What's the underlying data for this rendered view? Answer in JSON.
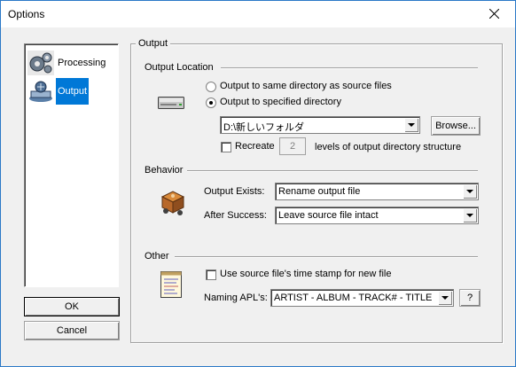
{
  "window": {
    "title": "Options"
  },
  "sidebar": {
    "items": [
      {
        "label": "Processing",
        "icon": "gears-icon",
        "selected": false
      },
      {
        "label": "Output",
        "icon": "output-icon",
        "selected": true
      }
    ]
  },
  "buttons": {
    "ok": "OK",
    "cancel": "Cancel"
  },
  "panel": {
    "title": "Output",
    "location": {
      "heading": "Output Location",
      "radio_same": "Output to same directory as source files",
      "radio_specified": "Output to specified directory",
      "selected_radio": "specified",
      "directory_value": "D:\\新しいフォルダ",
      "browse_label": "Browse...",
      "recreate_label": "Recreate",
      "recreate_checked": false,
      "recreate_levels": "2",
      "levels_label": "levels of output directory structure"
    },
    "behavior": {
      "heading": "Behavior",
      "output_exists_label": "Output Exists:",
      "output_exists_value": "Rename output file",
      "after_success_label": "After Success:",
      "after_success_value": "Leave source file intact"
    },
    "other": {
      "heading": "Other",
      "timestamp_label": "Use source file's time stamp for new file",
      "timestamp_checked": false,
      "naming_label": "Naming APL's:",
      "naming_value": "ARTIST - ALBUM - TRACK# - TITLE",
      "help_label": "?"
    }
  },
  "colors": {
    "selection": "#0078d7",
    "window_bg": "#f0f0f0",
    "border_accent": "#2b79c7"
  }
}
